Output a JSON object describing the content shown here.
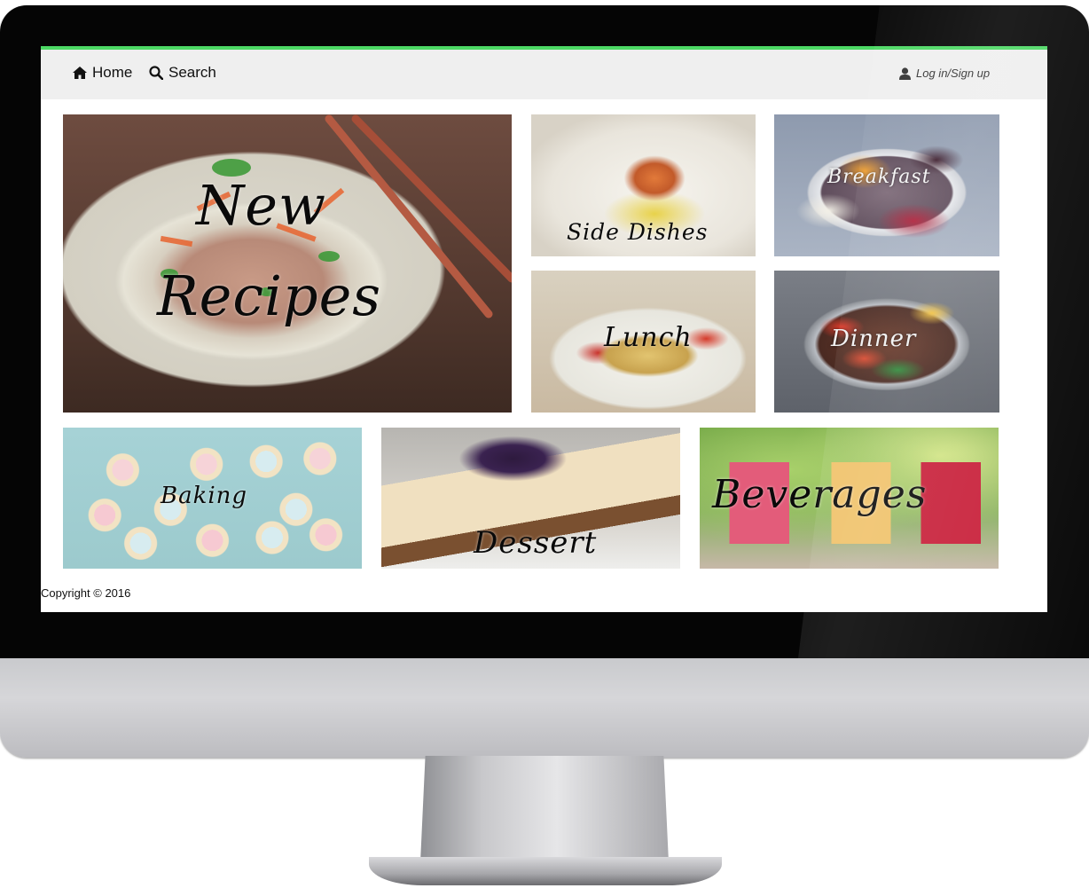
{
  "nav": {
    "home_label": "Home",
    "home_icon": "home-icon",
    "search_label": "Search",
    "search_icon": "search-icon",
    "login_label": "Log in/Sign up",
    "login_icon": "user-icon"
  },
  "categories": [
    {
      "label": "New Recipes",
      "line1": "New",
      "line2": "Recipes"
    },
    {
      "label": "Side Dishes"
    },
    {
      "label": "Breakfast"
    },
    {
      "label": "Lunch"
    },
    {
      "label": "Dinner"
    },
    {
      "label": "Baking"
    },
    {
      "label": "Dessert"
    },
    {
      "label": "Beverages"
    }
  ],
  "footer": {
    "copyright": "Copyright © 2016"
  },
  "colors": {
    "accent": "#4cd964",
    "navbar_bg": "#efefef",
    "bezel": "#050505"
  }
}
